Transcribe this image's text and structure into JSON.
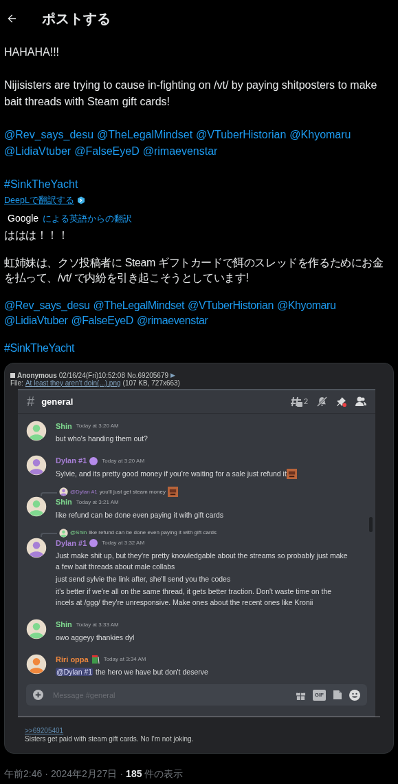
{
  "header": {
    "title": "ポストする"
  },
  "original": [
    {
      "kind": "text",
      "text": "HAHAHA!!!"
    },
    {
      "kind": "text",
      "text": "Nijisisters are trying to cause in-fighting on /vt/ by paying shitposters to make bait threads with Steam gift cards!"
    },
    {
      "kind": "mentions",
      "items": [
        "@Rev_says_desu",
        "@TheLegalMindset",
        "@VTuberHistorian",
        "@Khyomaru",
        "@LidiaVtuber",
        "@FalseEyeD",
        "@rimaevenstar"
      ]
    },
    {
      "kind": "mentions",
      "items": [
        "#SinkTheYacht"
      ]
    }
  ],
  "deepl": "DeepLで翻訳する",
  "google": {
    "brand": "Google",
    "label": "による英語からの翻訳"
  },
  "translated": [
    {
      "kind": "text",
      "text": "ははは！！！"
    },
    {
      "kind": "text",
      "text": "虹姉妹は、クソ投稿者に Steam ギフトカードで餌のスレッドを作るためにお金を払って、/vt/ で内紛を引き起こそうとしています!"
    },
    {
      "kind": "mentions",
      "items": [
        "@Rev_says_desu",
        "@TheLegalMindset",
        "@VTuberHistorian",
        "@Khyomaru",
        "@LidiaVtuber",
        "@FalseEyeD",
        "@rimaevenstar"
      ]
    },
    {
      "kind": "mentions",
      "items": [
        "#SinkTheYacht"
      ]
    }
  ],
  "embed": {
    "post": {
      "checked": false,
      "name": "Anonymous",
      "date": "02/16/24(Fri)10:52:08",
      "number": "No.69205679",
      "arrow": "▶",
      "file_label": "File:",
      "file_name": "At least they aren't doin(...).png",
      "file_meta": "(107 KB, 727x663)",
      "quote": ">>69205401",
      "comment": "Sisters get paid with steam gift cards. No I'm not joking."
    },
    "discord": {
      "channel_prefix": "#",
      "channel": "general",
      "threads": "2",
      "placeholder": "Message #general",
      "gif": "GIF",
      "messages": [
        {
          "author": "Shin",
          "color": "#7fd88f",
          "time": "Today at 3:20 AM",
          "lines": [
            "but who's handing them out?"
          ]
        },
        {
          "author": "Dylan #1",
          "color": "#a77fd6",
          "badge": {
            "kind": "orb"
          },
          "time": "Today at 3:20 AM",
          "lines": [
            "Sylvie, and its pretty good money if you're waiting for a sale just refund it"
          ],
          "emoji": true
        },
        {
          "reply": {
            "mention": "@Dylan #1",
            "color": "#a77fd6",
            "text": "you'll just get steam money",
            "emoji": true
          },
          "author": "Shin",
          "color": "#7fd88f",
          "time": "Today at 3:21 AM",
          "lines": [
            "like refund can be done even paying it with gift cards"
          ]
        },
        {
          "reply": {
            "mention": "@Shin",
            "color": "#7fd88f",
            "text": "like refund can be done even paying it with gift cards"
          },
          "author": "Dylan #1",
          "color": "#a77fd6",
          "badge": {
            "kind": "orb"
          },
          "time": "Today at 3:32 AM",
          "lines": [
            "Just make shit up, but they're pretty knowledgable about the streams so probably just make a few bait threads about male collabs",
            "just send sylvie the link after, she'll send you the codes",
            "it's better if we're all on the same thread, it gets better traction. Don't waste time on the incels at /ggg/ they're unresponsive. Make ones about the recent ones like Kronii"
          ]
        },
        {
          "author": "Shin",
          "color": "#7fd88f",
          "time": "Today at 3:33 AM",
          "lines": [
            "owo aggeyy thankies dyl"
          ]
        },
        {
          "author": "Riri oppa",
          "color": "#f0883e",
          "badge": {
            "kind": "drink"
          },
          "time": "Today at 3:34 AM",
          "mention": "@Dylan #1",
          "lines": [
            "the hero we have but don't deserve"
          ]
        }
      ]
    }
  },
  "meta": {
    "time": "午前2:46",
    "separator": "·",
    "date": "2024年2月27日",
    "views": "185",
    "views_label": "件の表示"
  }
}
